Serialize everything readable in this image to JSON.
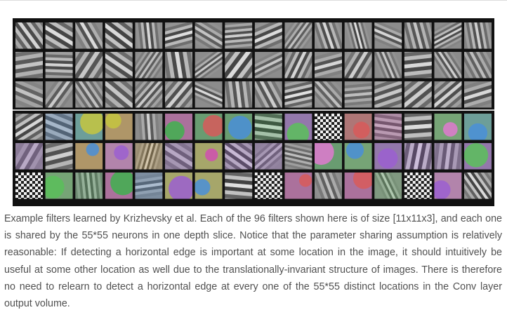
{
  "figure": {
    "image_alt": "96 learned convolutional filters arranged in a grid",
    "grid_rows": 6,
    "grid_cols": 16,
    "filter_count": 96,
    "border_color": "#111111",
    "background_gray": "#8c8c8c",
    "top_block_style": "grayscale oriented edge detectors",
    "bottom_block_style": "color blobs and high-frequency patterns"
  },
  "caption": {
    "text": "Example filters learned by Krizhevsky et al. Each of the 96 filters shown here is of size [11x11x3], and each one is shared by the 55*55 neurons in one depth slice. Notice that the parameter sharing assumption is relatively reasonable: If detecting a horizontal edge is important at some location in the image, it should intuitively be useful at some other location as well due to the translationally-invariant structure of images. There is therefore no need to relearn to detect a horizontal edge at every one of the 55*55 distinct locations in the Conv layer output volume."
  }
}
